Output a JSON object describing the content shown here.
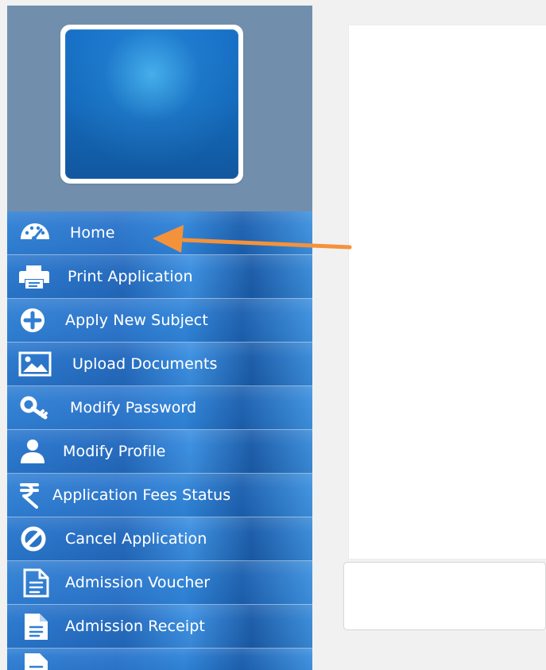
{
  "sidebar": {
    "items": [
      {
        "label": "Home",
        "icon": "dashboard-icon"
      },
      {
        "label": "Print Application",
        "icon": "printer-icon"
      },
      {
        "label": "Apply New Subject",
        "icon": "add-circle-icon"
      },
      {
        "label": "Upload Documents",
        "icon": "image-icon"
      },
      {
        "label": "Modify Password",
        "icon": "key-icon"
      },
      {
        "label": "Modify Profile",
        "icon": "user-icon"
      },
      {
        "label": "Application Fees Status",
        "icon": "rupee-icon"
      },
      {
        "label": "Cancel Application",
        "icon": "cancel-icon"
      },
      {
        "label": "Admission Voucher",
        "icon": "document-icon"
      },
      {
        "label": "Admission Receipt",
        "icon": "receipt-icon"
      },
      {
        "label": "",
        "icon": "document-icon"
      }
    ]
  },
  "colors": {
    "sidebar_bg": "#718fad",
    "menu_blue": "#2f7fd4",
    "arrow": "#f4923b",
    "content_bg": "#f1f1f1"
  }
}
